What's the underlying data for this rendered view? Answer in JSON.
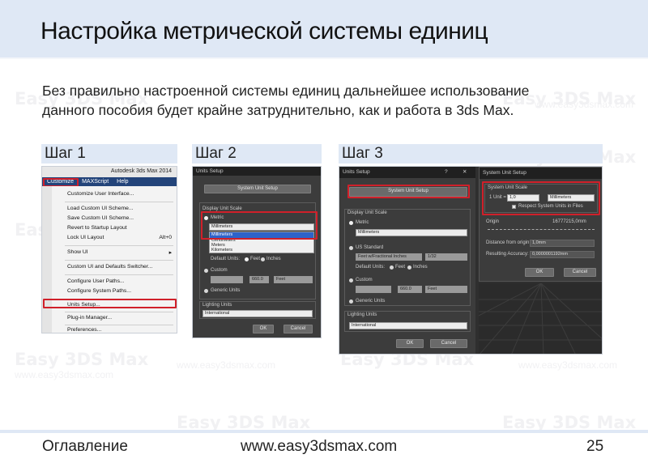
{
  "page": {
    "title": "Настройка метрической системы единиц",
    "intro_line1": "Без правильно настроенной системы единиц дальнейшее использование",
    "intro_line2": "данного пособия будет крайне затруднительно, как и работа в 3ds Max.",
    "watermark": "Easy 3DS Max",
    "watermark_sub": "www.easy3dsmax.com"
  },
  "steps": [
    {
      "label": "Шаг 1"
    },
    {
      "label": "Шаг 2"
    },
    {
      "label": "Шаг 3"
    }
  ],
  "step1": {
    "app_title": "Autodesk 3ds Max 2014",
    "menubar": [
      "Customize",
      "MAXScript",
      "Help"
    ],
    "menu_items": [
      {
        "label": "Customize User Interface...",
        "shortcut": ""
      },
      {
        "label": "Load Custom UI Scheme...",
        "shortcut": ""
      },
      {
        "label": "Save Custom UI Scheme...",
        "shortcut": ""
      },
      {
        "label": "Revert to Startup Layout",
        "shortcut": ""
      },
      {
        "label": "Lock UI Layout",
        "shortcut": "Alt+0"
      },
      {
        "label": "Show UI",
        "shortcut": "▸"
      },
      {
        "label": "Custom UI and Defaults Switcher...",
        "shortcut": ""
      },
      {
        "label": "Configure User Paths...",
        "shortcut": ""
      },
      {
        "label": "Configure System Paths...",
        "shortcut": ""
      },
      {
        "label": "Units Setup...",
        "shortcut": ""
      },
      {
        "label": "Plug-in Manager...",
        "shortcut": ""
      },
      {
        "label": "Preferences...",
        "shortcut": ""
      }
    ]
  },
  "step2": {
    "dialog_title": "Units Setup",
    "system_unit_button": "System Unit Setup",
    "display_group": "Display Unit Scale",
    "metric_label": "Metric",
    "metric_value": "Millimeters",
    "dropdown_options": [
      "Millimeters",
      "Centimeters",
      "Meters",
      "Kilometers"
    ],
    "default_units": "Default Units:",
    "feet_label": "Feet",
    "inches_label": "Inches",
    "custom_label": "Custom",
    "custom_value": "660.0",
    "custom_unit": "Feet",
    "generic_label": "Generic Units",
    "lighting_group": "Lighting Units",
    "lighting_value": "International",
    "ok": "OK",
    "cancel": "Cancel"
  },
  "step3": {
    "units_title": "Units Setup",
    "help_glyph": "?",
    "close_glyph": "✕",
    "system_unit_button": "System Unit Setup",
    "display_group": "Display Unit Scale",
    "metric_label": "Metric",
    "metric_value": "Millimeters",
    "us_label": "US Standard",
    "us_value": "Feet w/Fractional Inches",
    "us_fraction": "1/32",
    "default_units": "Default Units:",
    "feet_label": "Feet",
    "inches_label": "Inches",
    "custom_label": "Custom",
    "custom_value": "660.0",
    "custom_unit": "Feet",
    "generic_label": "Generic Units",
    "lighting_group": "Lighting Units",
    "lighting_value": "International",
    "ok": "OK",
    "cancel": "Cancel",
    "system_title": "System Unit Setup",
    "scale_group": "System Unit Scale",
    "unit_prefix": "1 Unit =",
    "unit_value": "1,0",
    "unit_choice": "Millimeters",
    "respect_label": "Respect System Units in Files",
    "origin_label": "Origin",
    "origin_value": "16777215,0mm",
    "distance_label": "Distance from origin:",
    "distance_value": "1,0mm",
    "accuracy_label": "Resulting Accuracy:",
    "accuracy_value": "0,0000001192mm",
    "ok2": "OK",
    "cancel2": "Cancel"
  },
  "footer": {
    "toc": "Оглавление",
    "site": "www.easy3dsmax.com",
    "page_number": "25"
  },
  "colors": {
    "accent_band": "#dfe8f5",
    "highlight": "#d0202a",
    "menu_bar": "#23447a"
  }
}
